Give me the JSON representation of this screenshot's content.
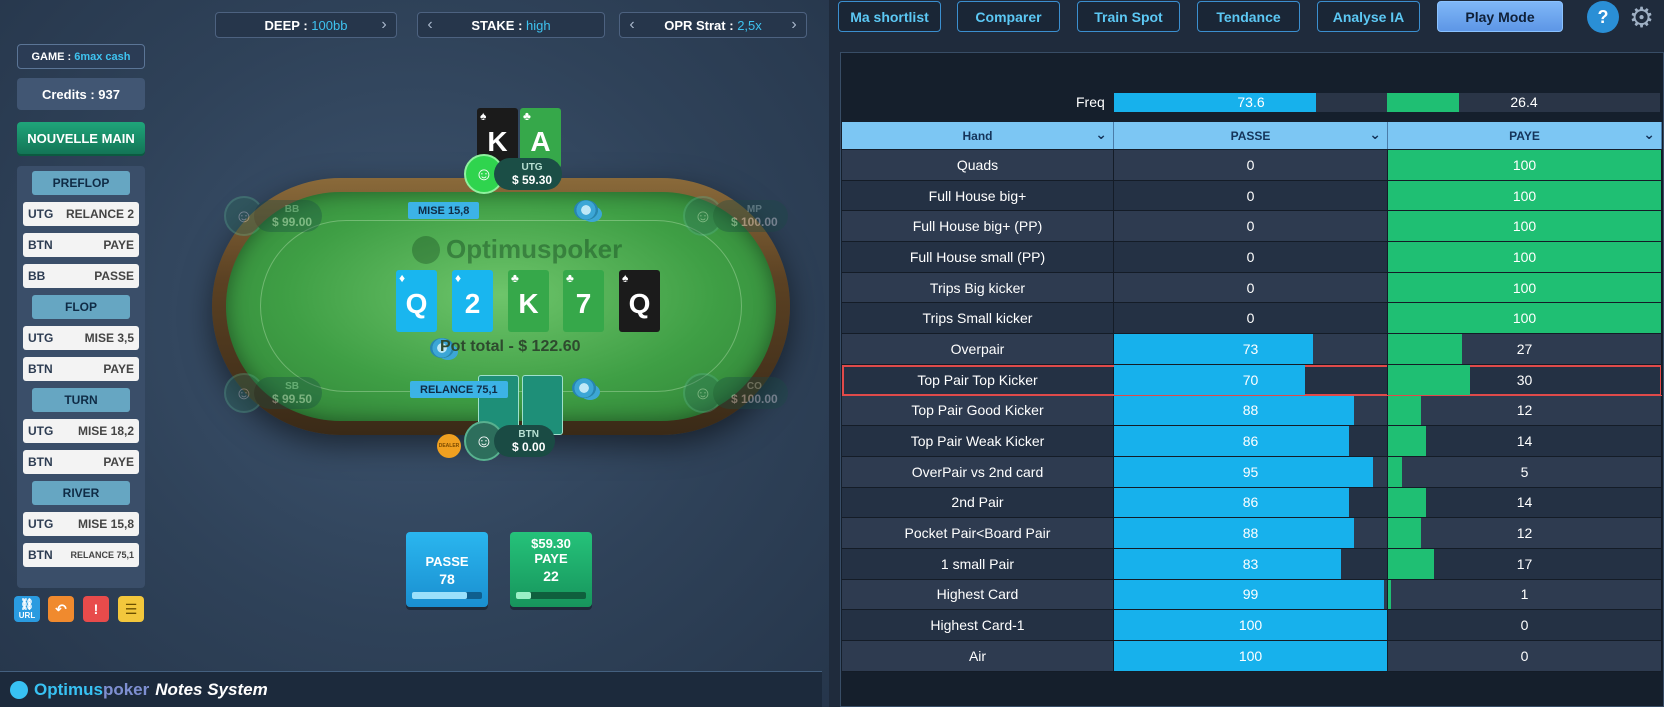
{
  "top_selectors": [
    {
      "label": "DEEP :",
      "value": "100bb"
    },
    {
      "label": "STAKE :",
      "value": "high"
    },
    {
      "label": "OPR Strat :",
      "value": "2,5x"
    }
  ],
  "game": {
    "label": "GAME :",
    "value": "6max cash"
  },
  "credits": "Credits : 937",
  "new_hand": "NOUVELLE MAIN",
  "history": {
    "preflop": "PREFLOP",
    "flop": "FLOP",
    "turn": "TURN",
    "river": "RIVER",
    "actions": [
      {
        "pos": "UTG",
        "action": "RELANCE 2"
      },
      {
        "pos": "BTN",
        "action": "PAYE"
      },
      {
        "pos": "BB",
        "action": "PASSE"
      },
      {
        "pos": "UTG",
        "action": "MISE 3,5"
      },
      {
        "pos": "BTN",
        "action": "PAYE"
      },
      {
        "pos": "UTG",
        "action": "MISE 18,2"
      },
      {
        "pos": "BTN",
        "action": "PAYE"
      },
      {
        "pos": "UTG",
        "action": "MISE 15,8"
      },
      {
        "pos": "BTN",
        "action": "RELANCE 75,1"
      }
    ]
  },
  "quick_icons": {
    "link": "URL",
    "undo": "undo-icon",
    "alert": "!",
    "notes": "notes-icon"
  },
  "table": {
    "logo": "Optimuspoker",
    "pot": "Pot total - $ 122.60",
    "utg_cards": [
      {
        "rank": "K",
        "suit": "♠"
      },
      {
        "rank": "A",
        "suit": "♣"
      }
    ],
    "board": [
      {
        "rank": "Q",
        "suit": "♦"
      },
      {
        "rank": "2",
        "suit": "♦"
      },
      {
        "rank": "K",
        "suit": "♣"
      },
      {
        "rank": "7",
        "suit": "♣"
      },
      {
        "rank": "Q",
        "suit": "♠"
      }
    ],
    "seats": {
      "utg": {
        "pos": "UTG",
        "stack": "$ 59.30"
      },
      "bb": {
        "pos": "BB",
        "stack": "$ 99.00"
      },
      "mp": {
        "pos": "MP",
        "stack": "$ 100.00"
      },
      "sb": {
        "pos": "SB",
        "stack": "$ 99.50"
      },
      "co": {
        "pos": "CO",
        "stack": "$ 100.00"
      },
      "btn": {
        "pos": "BTN",
        "stack": "$ 0.00"
      }
    },
    "mise_tag": "MISE 15,8",
    "relance_tag": "RELANCE 75,1",
    "dealer": "DEALER"
  },
  "decision": {
    "fold": {
      "label": "PASSE",
      "value": "78",
      "fill": 0.78
    },
    "call": {
      "amount": "$59.30",
      "label": "PAYE",
      "value": "22",
      "fill": 0.22
    }
  },
  "notes_bar": {
    "brand1": "Optimus",
    "brand2": "poker",
    "suffix": "Notes System"
  },
  "nav": [
    "Ma shortlist",
    "Comparer",
    "Train Spot",
    "Tendance",
    "Analyse IA",
    "Play Mode"
  ],
  "help": "?",
  "freq": {
    "label": "Freq",
    "passe": "73.6",
    "paye": "26.4",
    "passe_pct": 73.6,
    "paye_pct": 26.4
  },
  "columns": [
    "Hand",
    "PASSE",
    "PAYE"
  ],
  "rows": [
    {
      "hand": "Quads",
      "passe": "0",
      "paye": "100"
    },
    {
      "hand": "Full House big+",
      "passe": "0",
      "paye": "100"
    },
    {
      "hand": "Full House big+ (PP)",
      "passe": "0",
      "paye": "100"
    },
    {
      "hand": "Full House small (PP)",
      "passe": "0",
      "paye": "100"
    },
    {
      "hand": "Trips Big kicker",
      "passe": "0",
      "paye": "100"
    },
    {
      "hand": "Trips Small kicker",
      "passe": "0",
      "paye": "100"
    },
    {
      "hand": "Overpair",
      "passe": "73",
      "paye": "27"
    },
    {
      "hand": "Top Pair Top Kicker",
      "passe": "70",
      "paye": "30"
    },
    {
      "hand": "Top Pair Good Kicker",
      "passe": "88",
      "paye": "12"
    },
    {
      "hand": "Top Pair Weak Kicker",
      "passe": "86",
      "paye": "14"
    },
    {
      "hand": "OverPair vs 2nd card",
      "passe": "95",
      "paye": "5"
    },
    {
      "hand": "2nd Pair",
      "passe": "86",
      "paye": "14"
    },
    {
      "hand": "Pocket Pair<Board Pair",
      "passe": "88",
      "paye": "12"
    },
    {
      "hand": "1 small Pair",
      "passe": "83",
      "paye": "17"
    },
    {
      "hand": "Highest Card",
      "passe": "99",
      "paye": "1"
    },
    {
      "hand": "Highest Card-1",
      "passe": "100",
      "paye": "0"
    },
    {
      "hand": "Air",
      "passe": "100",
      "paye": "0"
    }
  ],
  "highlighted_row": "Top Pair Top Kicker",
  "colors": {
    "passe": "#17b1ec",
    "paye": "#1fbf73",
    "highlight": "#e04a4a"
  }
}
